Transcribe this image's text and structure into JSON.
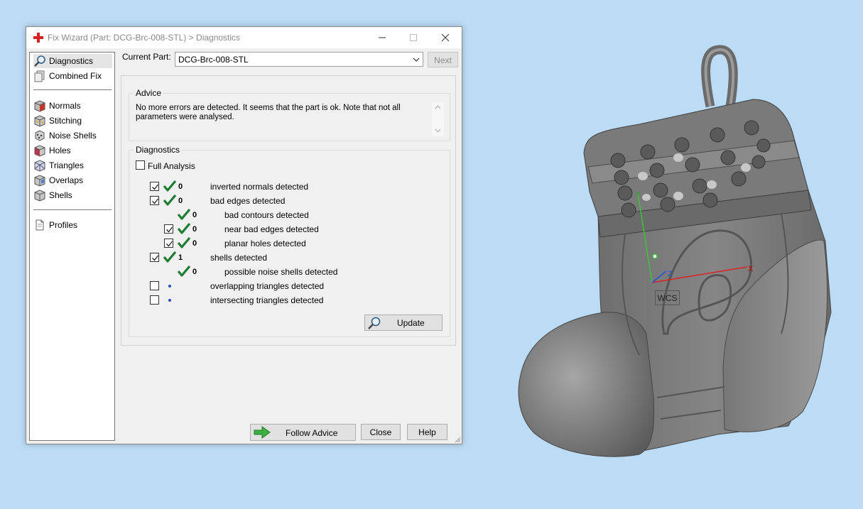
{
  "window": {
    "title": "Fix Wizard (Part: DCG-Brc-008-STL) > Diagnostics",
    "controls": [
      "minimize",
      "maximize",
      "close"
    ]
  },
  "nav": {
    "items": [
      {
        "label": "Diagnostics",
        "icon": "magnifier-icon",
        "selected": true
      },
      {
        "label": "Combined Fix",
        "icon": "combined-fix-icon"
      },
      {
        "label": "Normals",
        "icon": "normals-cube-icon"
      },
      {
        "label": "Stitching",
        "icon": "stitching-cube-icon"
      },
      {
        "label": "Noise Shells",
        "icon": "noise-shells-icon"
      },
      {
        "label": "Holes",
        "icon": "holes-cube-icon"
      },
      {
        "label": "Triangles",
        "icon": "triangles-cube-icon"
      },
      {
        "label": "Overlaps",
        "icon": "overlaps-cube-icon"
      },
      {
        "label": "Shells",
        "icon": "shells-cube-icon"
      },
      {
        "label": "Profiles",
        "icon": "profiles-document-icon"
      }
    ]
  },
  "part": {
    "label": "Current Part:",
    "value": "DCG-Brc-008-STL",
    "next_label": "Next"
  },
  "advice": {
    "title": "Advice",
    "text": "No more errors are detected. It seems that the part is ok. Note that not all parameters were analysed."
  },
  "diagnostics": {
    "title": "Diagnostics",
    "full_analysis": {
      "label": "Full Analysis",
      "checked": false
    },
    "rows": [
      {
        "checkbox": true,
        "checked": true,
        "status": "ok",
        "count": "0",
        "label": "inverted normals detected",
        "indent": 0
      },
      {
        "checkbox": true,
        "checked": true,
        "status": "ok",
        "count": "0",
        "label": "bad edges detected",
        "indent": 0
      },
      {
        "checkbox": false,
        "checked": false,
        "status": "ok",
        "count": "0",
        "label": "bad contours detected",
        "indent": 1
      },
      {
        "checkbox": true,
        "checked": true,
        "status": "ok",
        "count": "0",
        "label": "near bad edges detected",
        "indent": 1
      },
      {
        "checkbox": true,
        "checked": true,
        "status": "ok",
        "count": "0",
        "label": "planar holes detected",
        "indent": 1
      },
      {
        "checkbox": true,
        "checked": true,
        "status": "ok",
        "count": "1",
        "label": "shells detected",
        "indent": 0
      },
      {
        "checkbox": false,
        "checked": false,
        "status": "ok",
        "count": "0",
        "label": "possible noise shells detected",
        "indent": 1
      },
      {
        "checkbox": true,
        "checked": false,
        "status": "pending",
        "count": "",
        "label": "overlapping triangles detected",
        "indent": 0
      },
      {
        "checkbox": true,
        "checked": false,
        "status": "pending",
        "count": "",
        "label": "intersecting triangles detected",
        "indent": 0
      }
    ],
    "update_label": "Update"
  },
  "footer": {
    "follow_label": "Follow Advice",
    "close_label": "Close",
    "help_label": "Help"
  },
  "viewport": {
    "wcs_label": "WCS",
    "axis_x": "X",
    "axis_y": "Y",
    "axis_z": "Z"
  },
  "colors": {
    "desktop": "#bcdcf6",
    "check_green": "#1e7d32",
    "model_gray": "#7d7d7d"
  }
}
